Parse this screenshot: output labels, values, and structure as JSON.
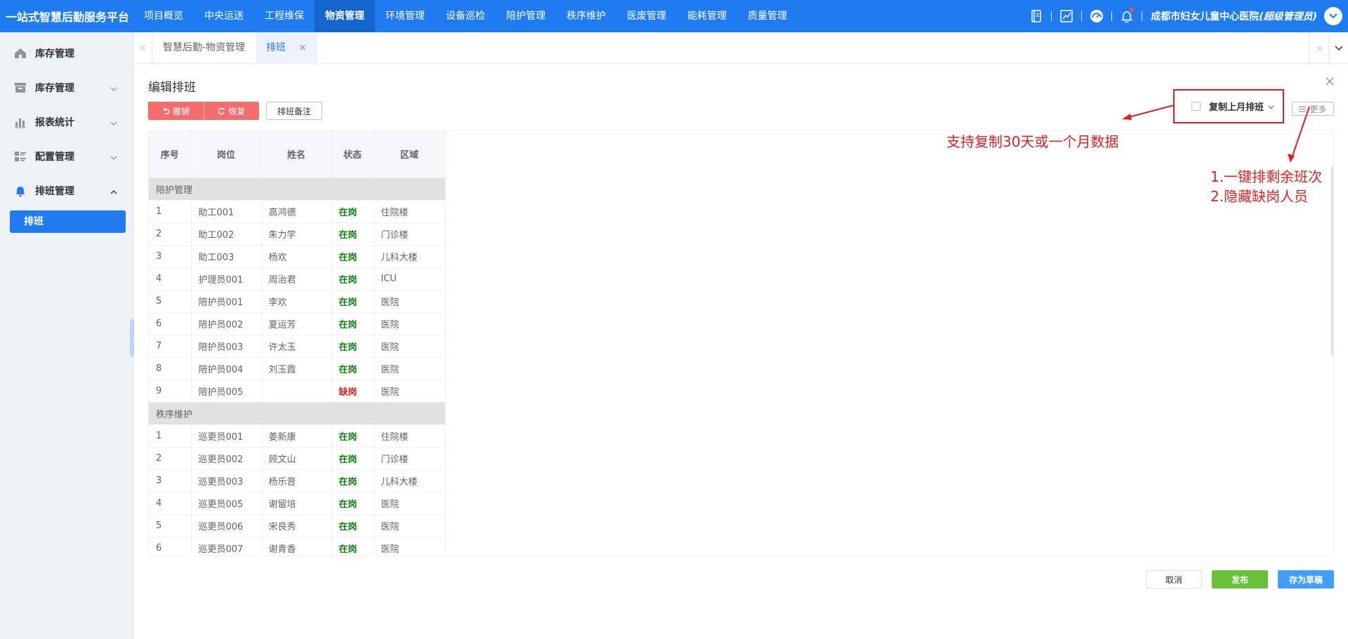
{
  "header": {
    "brand": "一站式智慧后勤服务平台",
    "nav": [
      "项目概览",
      "中央运送",
      "工程维保",
      "物资管理",
      "环境管理",
      "设备巡检",
      "陪护管理",
      "秩序维护",
      "医废管理",
      "能耗管理",
      "质量管理"
    ],
    "active_nav": "物资管理",
    "hospital": "成都市妇女儿童中心医院",
    "role": "(超级管理员)"
  },
  "sidebar": {
    "items": [
      {
        "label": "库存管理",
        "icon": "home-icon"
      },
      {
        "label": "库存管理",
        "icon": "box-icon"
      },
      {
        "label": "报表统计",
        "icon": "chart-icon"
      },
      {
        "label": "配置管理",
        "icon": "config-icon"
      },
      {
        "label": "排班管理",
        "icon": "bell-icon"
      }
    ],
    "sub_active": "排班"
  },
  "tabs": [
    {
      "label": "智慧后勤-物资管理",
      "active": false
    },
    {
      "label": "排班",
      "active": true,
      "close": "×"
    }
  ],
  "page": {
    "title": "编辑排班",
    "undo_label": "撤销",
    "redo_label": "恢复",
    "note_label": "排班备注",
    "copy_label": "复制上月排班",
    "more_label": "更多",
    "cancel_label": "取消",
    "publish_label": "发布",
    "draft_label": "存为草稿"
  },
  "table": {
    "headers": [
      "序号",
      "岗位",
      "姓名",
      "状态",
      "区域"
    ],
    "groups": [
      {
        "name": "陪护管理",
        "rows": [
          [
            "1",
            "助工001",
            "高鸿德",
            "在岗",
            "住院楼"
          ],
          [
            "2",
            "助工002",
            "朱力学",
            "在岗",
            "门诊楼"
          ],
          [
            "3",
            "助工003",
            "杨欢",
            "在岗",
            "儿科大楼"
          ],
          [
            "4",
            "护理员001",
            "周治君",
            "在岗",
            "ICU"
          ],
          [
            "5",
            "陪护员001",
            "李欢",
            "在岗",
            "医院"
          ],
          [
            "6",
            "陪护员002",
            "夏运芳",
            "在岗",
            "医院"
          ],
          [
            "7",
            "陪护员003",
            "许太玉",
            "在岗",
            "医院"
          ],
          [
            "8",
            "陪护员004",
            "刘玉霞",
            "在岗",
            "医院"
          ],
          [
            "9",
            "陪护员005",
            "",
            "缺岗",
            "医院"
          ]
        ]
      },
      {
        "name": "秩序维护",
        "rows": [
          [
            "1",
            "巡更员001",
            "姜新康",
            "在岗",
            "住院楼"
          ],
          [
            "2",
            "巡更员002",
            "顾文山",
            "在岗",
            "门诊楼"
          ],
          [
            "3",
            "巡更员003",
            "杨乐音",
            "在岗",
            "儿科大楼"
          ],
          [
            "4",
            "巡更员005",
            "谢留培",
            "在岗",
            "医院"
          ],
          [
            "5",
            "巡更员006",
            "宋良秀",
            "在岗",
            "医院"
          ],
          [
            "6",
            "巡更员007",
            "谢青香",
            "在岗",
            "医院"
          ]
        ]
      }
    ]
  },
  "annotations": {
    "copy_note": "支持复制30天或一个月数据",
    "more_note_1": "1.一键排剩余班次",
    "more_note_2": "2.隐藏缺岗人员",
    "color": "#e02020"
  },
  "colors": {
    "primary": "#1e7bf0",
    "danger": "#f56c6c",
    "success": "#67c23a",
    "on_duty": "#107c10",
    "off_duty": "#e02020"
  }
}
